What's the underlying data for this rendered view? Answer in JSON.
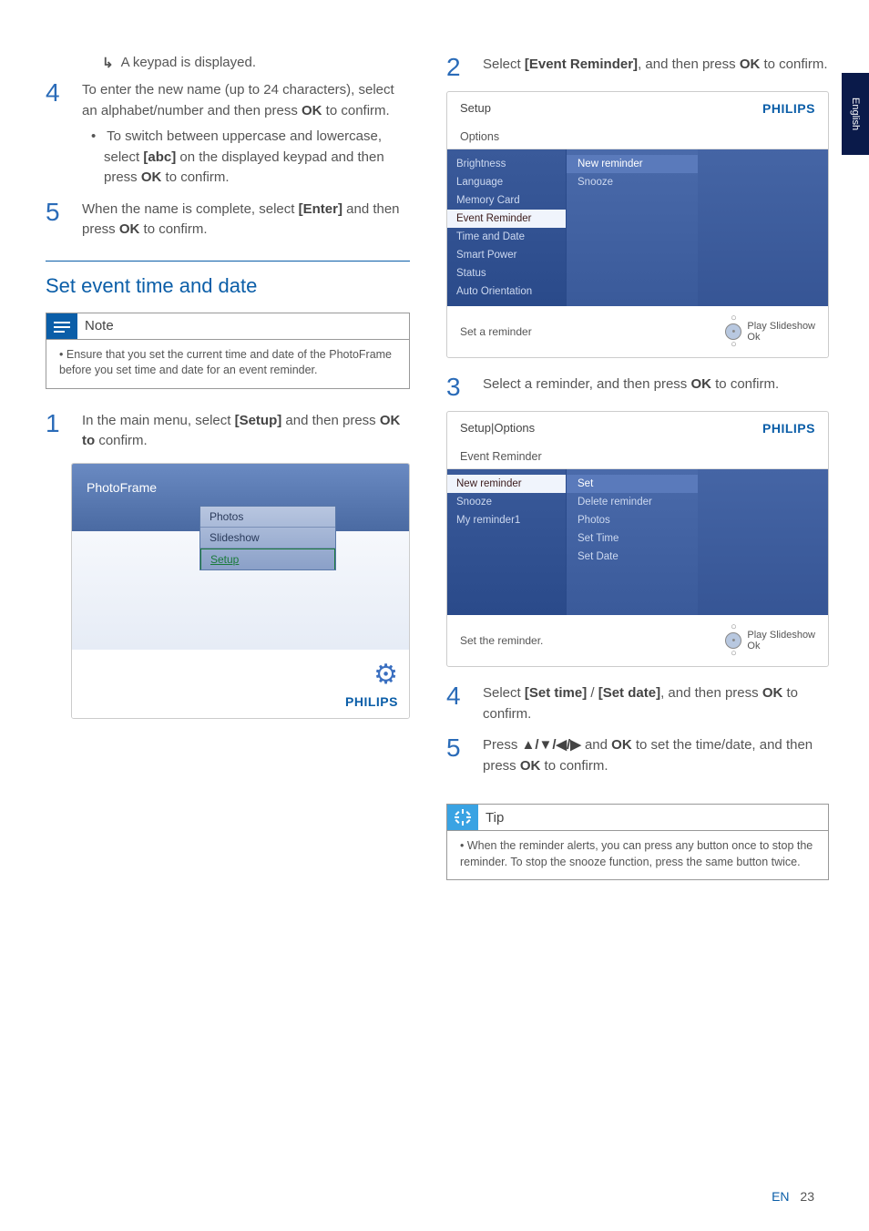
{
  "side_tab": "English",
  "left": {
    "result_arrow": "↳",
    "result_text": "A keypad is displayed.",
    "step4_num": "4",
    "step4_a": "To enter the new name (up to 24 characters), select an alphabet/number and then press ",
    "step4_ok": "OK",
    "step4_b": " to confirm.",
    "step4_bullet_a": "To switch between uppercase and lowercase, select ",
    "step4_bullet_bold1": "[abc]",
    "step4_bullet_b": " on the displayed keypad and then press ",
    "step4_bullet_bold2": "OK",
    "step4_bullet_c": " to confirm.",
    "step5_num": "5",
    "step5_a": "When the name is complete, select ",
    "step5_bold1": "[Enter]",
    "step5_b": " and then press ",
    "step5_bold2": "OK",
    "step5_c": " to confirm.",
    "section_heading": "Set event time and date",
    "note_title": "Note",
    "note_body": "Ensure that you set the current time and date of the PhotoFrame before you set time and date for an event reminder.",
    "step1_num": "1",
    "step1_a": "In the main menu, select ",
    "step1_bold1": "[Setup]",
    "step1_b": " and then press ",
    "step1_bold2": "OK to",
    "step1_c": " confirm.",
    "screenshot1": {
      "title": "PhotoFrame",
      "menu1": "Photos",
      "menu2": "Slideshow",
      "menu3": "Setup",
      "logo": "PHILIPS"
    }
  },
  "right": {
    "step2_num": "2",
    "step2_a": "Select ",
    "step2_bold1": "[Event Reminder]",
    "step2_b": ", and then press ",
    "step2_bold2": "OK",
    "step2_c": " to confirm.",
    "screenshot2": {
      "bc": "Setup",
      "logo": "PHILIPS",
      "sub": "Options",
      "left_items": [
        "Brightness",
        "Language",
        "Memory Card",
        "Event Reminder",
        "Time and Date",
        "Smart Power",
        "Status",
        "Auto Orientation"
      ],
      "right_items": [
        "New reminder",
        "Snooze"
      ],
      "footer_left": "Set a reminder",
      "foot_play": "Play Slideshow",
      "foot_ok": "Ok"
    },
    "step3_num": "3",
    "step3_a": "Select a reminder, and then press ",
    "step3_bold1": "OK",
    "step3_b": " to confirm.",
    "screenshot3": {
      "bc": "Setup|Options",
      "logo": "PHILIPS",
      "sub": "Event Reminder",
      "left_items": [
        "New reminder",
        "Snooze",
        "My reminder1"
      ],
      "right_items": [
        "Set",
        "Delete reminder",
        "Photos",
        "Set Time",
        "Set Date"
      ],
      "footer_left": "Set the reminder.",
      "foot_play": "Play Slideshow",
      "foot_ok": "Ok"
    },
    "step4_num": "4",
    "step4_a": "Select ",
    "step4_bold1": "[Set time]",
    "step4_mid": " / ",
    "step4_bold2": "[Set date]",
    "step4_b": ", and then press ",
    "step4_bold3": "OK",
    "step4_c": " to confirm.",
    "step5_num": "5",
    "step5_a": "Press ",
    "step5_arrows": "▲/▼/◀/▶",
    "step5_b": " and ",
    "step5_bold1": "OK",
    "step5_c": " to set the time/date, and then press ",
    "step5_bold2": "OK",
    "step5_d": " to confirm.",
    "tip_title": "Tip",
    "tip_body": "When the reminder alerts, you can press any button once to stop the reminder. To stop the snooze function, press the same button twice."
  },
  "footer": {
    "lang": "EN",
    "page": "23"
  }
}
